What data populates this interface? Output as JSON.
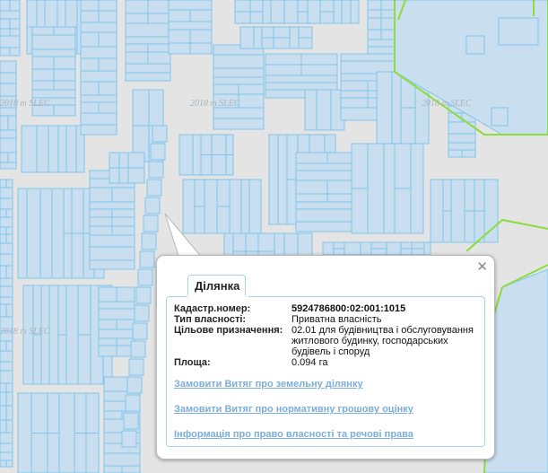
{
  "colors": {
    "map_background": "#e4e4e4",
    "parcel_fill": "#c9deee",
    "parcel_stroke": "#7fc5ec",
    "boundary_green": "#8cdc3c",
    "link": "#7aaedc"
  },
  "map": {
    "watermark": "2018 m SLEC"
  },
  "popup": {
    "tab_label": "Ділянка",
    "close_glyph": "✕",
    "fields": [
      {
        "key": "Кадастр.номер:",
        "value": "5924786800:02:001:1015"
      },
      {
        "key": "Тип власності:",
        "value": "Приватна власність"
      },
      {
        "key": "Цільове призначення:",
        "value": "02.01 для будівництва і обслуговування житлового будинку, господарських будівель і споруд"
      },
      {
        "key": "Площа:",
        "value": "0.094 га"
      }
    ],
    "links": [
      "Замовити Витяг про земельну ділянку",
      "Замовити Витяг про нормативну грошову оцінку",
      "Інформація про право власності та речові права"
    ]
  }
}
